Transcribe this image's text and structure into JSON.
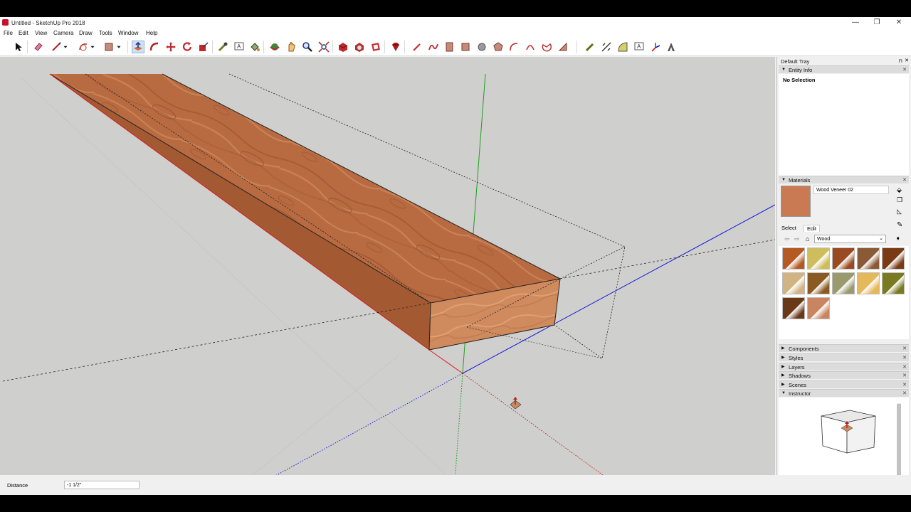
{
  "window": {
    "title": "Untitled - SketchUp Pro 2018",
    "minimize_glyph": "—",
    "restore_glyph": "❐",
    "close_glyph": "✕"
  },
  "menu": [
    "File",
    "Edit",
    "View",
    "Camera",
    "Draw",
    "Tools",
    "Window",
    "Help"
  ],
  "toolbar": {
    "tools": [
      "select-icon",
      "eraser-icon",
      "line-icon",
      "dropdown-icon",
      "arc-icon",
      "dropdown-icon",
      "rectangle-icon",
      "dropdown-icon",
      "push-pull-icon",
      "follow-me-icon",
      "move-icon",
      "rotate-icon",
      "scale-icon",
      "tape-measure-icon",
      "text-icon",
      "paint-bucket-icon",
      "orbit-icon",
      "pan-icon",
      "zoom-icon",
      "zoom-extents-icon",
      "warehouse-icon",
      "extension-warehouse-icon",
      "layout-icon",
      "ruby-icon",
      "pencil-icon",
      "freehand-icon",
      "section-icon",
      "offset-icon",
      "circle-icon",
      "polygon-icon",
      "arc-2pt-icon",
      "arc-3pt-icon",
      "pie-icon",
      "protractor-icon",
      "tape-icon",
      "axes-icon",
      "dimension-icon",
      "text-label-icon",
      "3d-text-icon",
      "position-camera-icon"
    ],
    "active_tool": "push-pull-icon"
  },
  "tray": {
    "title": "Default Tray",
    "entity_info": {
      "label": "Entity Info",
      "selection": "No Selection"
    },
    "materials": {
      "label": "Materials",
      "current_material": "Wood Veneer 02",
      "current_color": "#c97a52",
      "tabs": [
        "Select",
        "Edit"
      ],
      "library": "Wood",
      "swatches": [
        "#b45a22",
        "#cdbd5c",
        "#9a4a20",
        "#8a5a36",
        "#7a3a14",
        "#d2b382",
        "#8a5a22",
        "#9a9a6e",
        "#e6b85c",
        "#7a7a22",
        "#6a3a18",
        "#c98560"
      ]
    },
    "collapsed_panels": [
      "Components",
      "Styles",
      "Layers",
      "Shadows",
      "Scenes"
    ],
    "instructor": {
      "label": "Instructor"
    }
  },
  "measurements": {
    "label": "Distance",
    "value": "-1 1/2\""
  },
  "colors": {
    "viewport_bg": "#cfcfcd",
    "red_axis": "#d81b1b",
    "green_axis": "#1ea01e",
    "blue_axis": "#1b1bd8",
    "wood_top": "#b86a40",
    "wood_front": "#cf8a5e"
  }
}
